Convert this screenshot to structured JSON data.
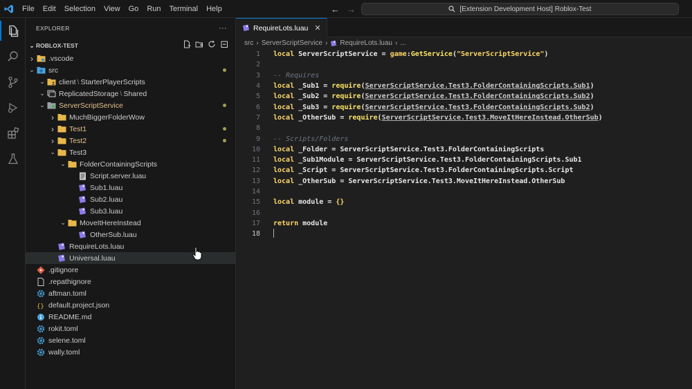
{
  "menu": [
    "File",
    "Edit",
    "Selection",
    "View",
    "Go",
    "Run",
    "Terminal",
    "Help"
  ],
  "command_center": "[Extension Development Host] Roblox-Test",
  "explorer": {
    "title": "EXPLORER",
    "more": "···",
    "section": "ROBLOX-TEST",
    "tree": [
      {
        "indent": 0,
        "chevron": "right",
        "icon": "folder-gear",
        "label": ".vscode"
      },
      {
        "indent": 0,
        "chevron": "down",
        "icon": "folder-src",
        "label": "src",
        "dot": true
      },
      {
        "indent": 1,
        "chevron": "down",
        "icon": "folder-client",
        "label": "client",
        "suffix": "StarterPlayerScripts"
      },
      {
        "indent": 1,
        "chevron": "down",
        "icon": "folder-replicated",
        "label": "ReplicatedStorage",
        "suffix": "Shared"
      },
      {
        "indent": 1,
        "chevron": "down",
        "icon": "folder-server",
        "label": "ServerScriptService",
        "modified": true,
        "dot": true
      },
      {
        "indent": 2,
        "chevron": "right",
        "icon": "folder",
        "label": "MuchBiggerFolderWow"
      },
      {
        "indent": 2,
        "chevron": "right",
        "icon": "folder",
        "label": "Test1",
        "modified": true,
        "dot": true
      },
      {
        "indent": 2,
        "chevron": "right",
        "icon": "folder",
        "label": "Test2",
        "modified": true,
        "dot": true
      },
      {
        "indent": 2,
        "chevron": "down",
        "icon": "folder",
        "label": "Test3"
      },
      {
        "indent": 3,
        "chevron": "down",
        "icon": "folder",
        "label": "FolderContainingScripts"
      },
      {
        "indent": 4,
        "chevron": "none",
        "icon": "file-script",
        "label": "Script.server.luau"
      },
      {
        "indent": 4,
        "chevron": "none",
        "icon": "file-luau",
        "label": "Sub1.luau"
      },
      {
        "indent": 4,
        "chevron": "none",
        "icon": "file-luau",
        "label": "Sub2.luau"
      },
      {
        "indent": 4,
        "chevron": "none",
        "icon": "file-luau",
        "label": "Sub3.luau"
      },
      {
        "indent": 3,
        "chevron": "down",
        "icon": "folder",
        "label": "MoveItHereInstead"
      },
      {
        "indent": 4,
        "chevron": "none",
        "icon": "file-luau",
        "label": "OtherSub.luau"
      },
      {
        "indent": 2,
        "chevron": "none",
        "icon": "file-luau",
        "label": "RequireLots.luau"
      },
      {
        "indent": 2,
        "chevron": "none",
        "icon": "file-luau",
        "label": "Universal.luau",
        "selected": true
      },
      {
        "indent": 0,
        "chevron": "none",
        "icon": "file-git",
        "label": ".gitignore"
      },
      {
        "indent": 0,
        "chevron": "none",
        "icon": "file-plain",
        "label": ".repathignore"
      },
      {
        "indent": 0,
        "chevron": "none",
        "icon": "file-gear",
        "label": "aftman.toml"
      },
      {
        "indent": 0,
        "chevron": "none",
        "icon": "file-json",
        "label": "default.project.json"
      },
      {
        "indent": 0,
        "chevron": "none",
        "icon": "file-info",
        "label": "README.md"
      },
      {
        "indent": 0,
        "chevron": "none",
        "icon": "file-gear",
        "label": "rokit.toml"
      },
      {
        "indent": 0,
        "chevron": "none",
        "icon": "file-gear",
        "label": "selene.toml"
      },
      {
        "indent": 0,
        "chevron": "none",
        "icon": "file-gear",
        "label": "wally.toml"
      }
    ]
  },
  "editor": {
    "tab": "RequireLots.luau",
    "breadcrumb": [
      "src",
      "ServerScriptService",
      "RequireLots.luau",
      "..."
    ],
    "current_line": 18,
    "lines": [
      [
        [
          "k",
          "local"
        ],
        [
          "v",
          " ServerScriptService = "
        ],
        [
          "k",
          "game"
        ],
        [
          "v",
          ":"
        ],
        [
          "f",
          "GetService"
        ],
        [
          "v",
          "("
        ],
        [
          "s",
          "\"ServerScriptService\""
        ],
        [
          "v",
          ")"
        ]
      ],
      [],
      [
        [
          "c",
          "-- Requires"
        ]
      ],
      [
        [
          "k",
          "local"
        ],
        [
          "v",
          " _Sub1 = "
        ],
        [
          "f",
          "require"
        ],
        [
          "v",
          "("
        ],
        [
          "u",
          "ServerScriptService.Test3.FolderContainingScripts.Sub1"
        ],
        [
          "v",
          ")"
        ]
      ],
      [
        [
          "k",
          "local"
        ],
        [
          "v",
          " _Sub2 = "
        ],
        [
          "f",
          "require"
        ],
        [
          "v",
          "("
        ],
        [
          "u",
          "ServerScriptService.Test3.FolderContainingScripts.Sub2"
        ],
        [
          "v",
          ")"
        ]
      ],
      [
        [
          "k",
          "local"
        ],
        [
          "v",
          " _Sub3 = "
        ],
        [
          "f",
          "require"
        ],
        [
          "v",
          "("
        ],
        [
          "u",
          "ServerScriptService.Test3.FolderContainingScripts.Sub2"
        ],
        [
          "v",
          ")"
        ]
      ],
      [
        [
          "k",
          "local"
        ],
        [
          "v",
          " _OtherSub = "
        ],
        [
          "f",
          "require"
        ],
        [
          "v",
          "("
        ],
        [
          "u",
          "ServerScriptService.Test3.MoveItHereInstead.OtherSub"
        ],
        [
          "v",
          ")"
        ]
      ],
      [],
      [
        [
          "c",
          "-- Scripts/Folders"
        ]
      ],
      [
        [
          "k",
          "local"
        ],
        [
          "v",
          " _Folder = ServerScriptService.Test3.FolderContainingScripts"
        ]
      ],
      [
        [
          "k",
          "local"
        ],
        [
          "v",
          " _Sub1Module = ServerScriptService.Test3.FolderContainingScripts.Sub1"
        ]
      ],
      [
        [
          "k",
          "local"
        ],
        [
          "v",
          " _Script = ServerScriptService.Test3.FolderContainingScripts.Script"
        ]
      ],
      [
        [
          "k",
          "local"
        ],
        [
          "v",
          " _OtherSub = ServerScriptService.Test3.MoveItHereInstead.OtherSub"
        ]
      ],
      [],
      [
        [
          "k",
          "local"
        ],
        [
          "v",
          " module = "
        ],
        [
          "k",
          "{}"
        ]
      ],
      [],
      [
        [
          "k",
          "return"
        ],
        [
          "v",
          " module"
        ]
      ],
      []
    ]
  }
}
